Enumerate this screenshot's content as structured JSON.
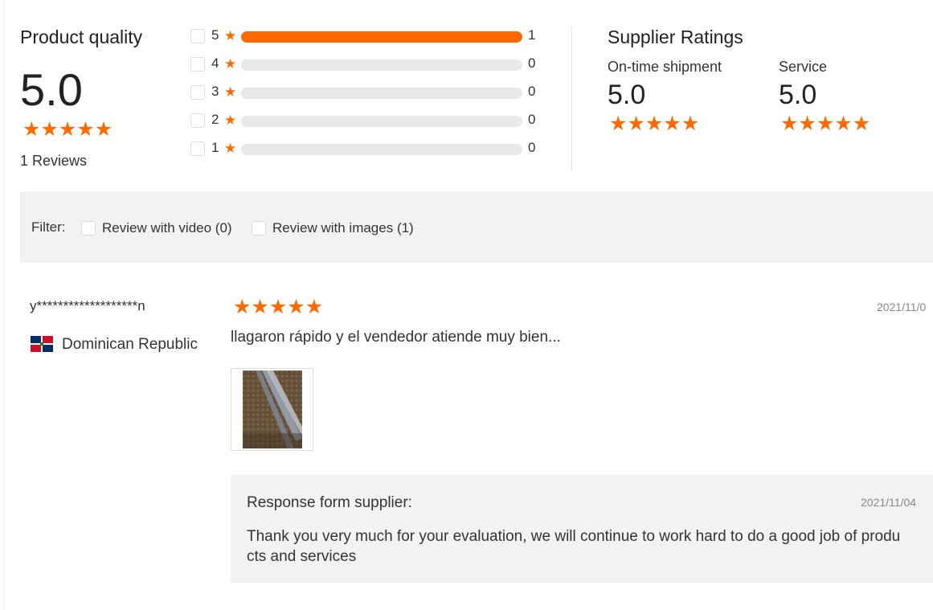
{
  "product_quality": {
    "title": "Product quality",
    "score": "5.0",
    "stars": 5,
    "reviews_label": "1 Reviews"
  },
  "histogram": [
    {
      "stars": "5",
      "count": "1",
      "fill_fraction": 1.0
    },
    {
      "stars": "4",
      "count": "0",
      "fill_fraction": 0
    },
    {
      "stars": "3",
      "count": "0",
      "fill_fraction": 0
    },
    {
      "stars": "2",
      "count": "0",
      "fill_fraction": 0
    },
    {
      "stars": "1",
      "count": "0",
      "fill_fraction": 0
    }
  ],
  "supplier": {
    "title": "Supplier Ratings",
    "ontime_label": "On-time shipment",
    "ontime_score": "5.0",
    "service_label": "Service",
    "service_score": "5.0"
  },
  "filter": {
    "label": "Filter:",
    "video_option": "Review with video (0)",
    "images_option": "Review with images (1)"
  },
  "review": {
    "user": "y*******************n",
    "country": "Dominican Republic",
    "stars": 5,
    "date": "2021/11/0",
    "text": "llagaron rápido y el vendedor atiende muy bien..."
  },
  "response": {
    "label": "Response form supplier:",
    "date": "2021/11/04",
    "text_line1": "Thank you very much for your evaluation, we will continue to work hard to do a good job of produ",
    "text_line2": "cts and services"
  },
  "colors": {
    "accent": "#ff6a00",
    "panel": "#f2f2f2"
  }
}
